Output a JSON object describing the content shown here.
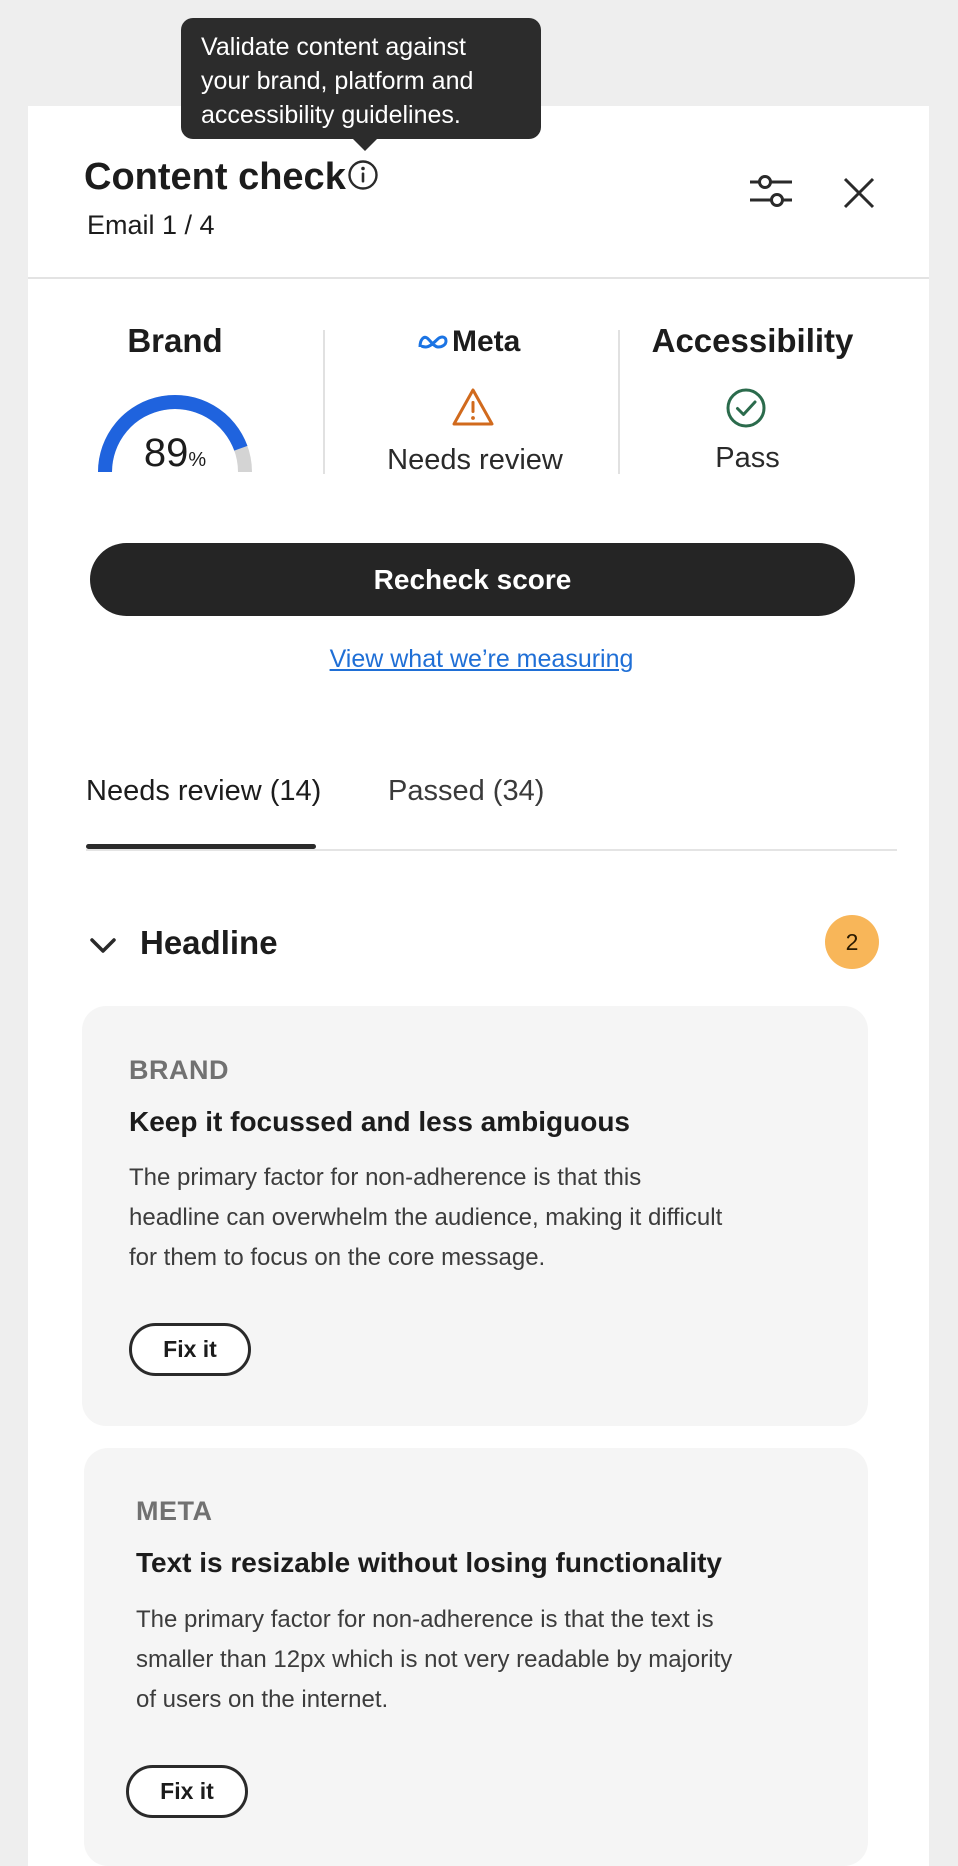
{
  "tooltip": {
    "text": "Validate content against your brand, platform and accessibility guidelines."
  },
  "header": {
    "title": "Content check",
    "subtitle": "Email 1 / 4"
  },
  "scores": {
    "brand": {
      "label": "Brand",
      "value": "89",
      "unit": "%",
      "fraction": 0.89,
      "accent_color": "#1f63de"
    },
    "meta": {
      "label": "Meta",
      "status": "Needs review",
      "status_color": "#d16a1d",
      "logo_color": "#1b74e4"
    },
    "accessibility": {
      "label": "Accessibility",
      "status": "Pass",
      "status_color": "#2b6b4c"
    }
  },
  "actions": {
    "recheck_label": "Recheck score",
    "measure_link": "View what we’re measuring"
  },
  "tabs": [
    {
      "label": "Needs review (14)",
      "active": true
    },
    {
      "label": "Passed (34)",
      "active": false
    }
  ],
  "section": {
    "title": "Headline",
    "count": "2",
    "badge_color": "#f8b659"
  },
  "cards": [
    {
      "category": "BRAND",
      "title": "Keep it focussed and less ambiguous",
      "body": [
        "The primary factor for non-adherence is that this",
        "headline can overwhelm the audience, making it difficult",
        "for them to focus on the core message."
      ],
      "button": "Fix it"
    },
    {
      "category": "META",
      "title": "Text is resizable without losing functionality",
      "body": [
        "The primary factor for non-adherence is that the text is",
        "smaller than 12px which is not very readable by majority",
        "of users on the internet."
      ],
      "button": "Fix it"
    }
  ]
}
